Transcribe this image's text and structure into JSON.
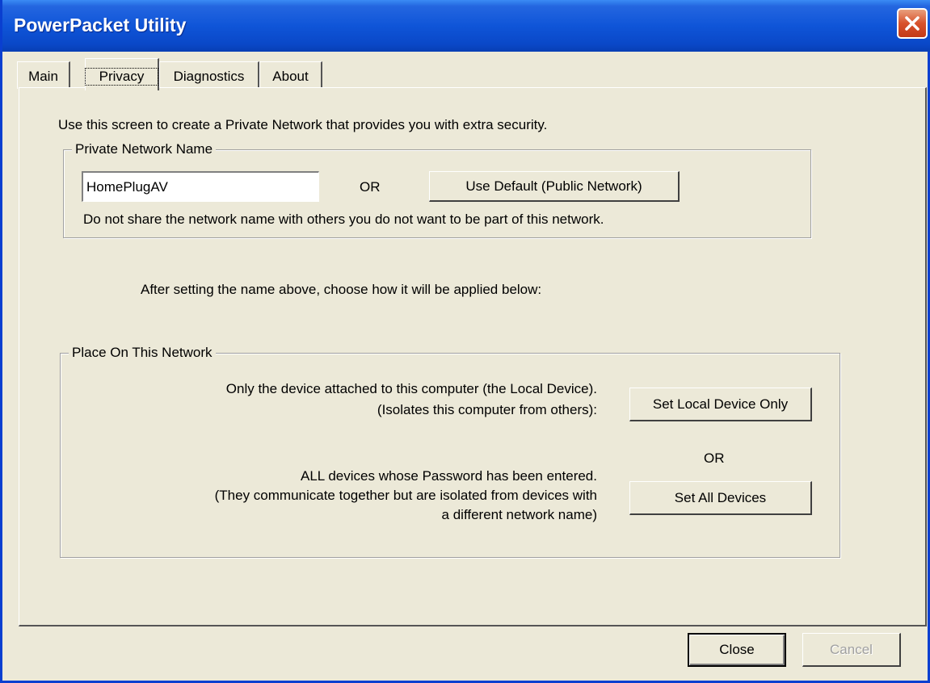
{
  "window": {
    "title": "PowerPacket Utility"
  },
  "tabs": [
    {
      "label": "Main"
    },
    {
      "label": "Privacy"
    },
    {
      "label": "Diagnostics"
    },
    {
      "label": "About"
    }
  ],
  "privacy": {
    "intro": "Use this screen to create a Private Network that provides you with extra security.",
    "network_group": {
      "legend": "Private Network Name",
      "name_value": "HomePlugAV",
      "or_label": "OR",
      "default_button": "Use Default (Public Network)",
      "warning": "Do not share the network name with others you do not want to be part of this network."
    },
    "instruction": "After setting the name above, choose how it will be applied below:",
    "place_group": {
      "legend": "Place On This Network",
      "local_line1": "Only the device attached to this computer (the Local Device).",
      "local_line2": "(Isolates this computer from others):",
      "local_button": "Set Local Device Only",
      "or_label": "OR",
      "all_line1": "ALL devices whose Password has been entered.",
      "all_line2": "(They communicate together but are isolated from devices with",
      "all_line3": "a different network name)",
      "all_button": "Set All Devices"
    }
  },
  "footer": {
    "close_button": "Close",
    "cancel_button": "Cancel"
  }
}
